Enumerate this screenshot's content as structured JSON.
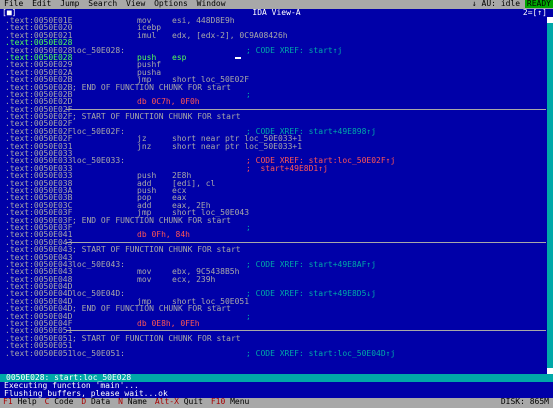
{
  "menu": [
    "File",
    "Edit",
    "Jump",
    "Search",
    "View",
    "Options",
    "Window"
  ],
  "status": {
    "au": "AU: idle",
    "arrow": "↓",
    "ready": "READY"
  },
  "window": {
    "title": "IDA View-A",
    "close": "[■]",
    "number": "2=[↑]"
  },
  "lines": [
    {
      "addr": ".text:0050E01E",
      "mn": "mov",
      "op": "esi, 448D8E9h",
      "pink": false
    },
    {
      "addr": ".text:0050E020",
      "mn": "icebp",
      "op": ""
    },
    {
      "addr": ".text:0050E021",
      "mn": "imul",
      "op": "edx, [edx-2], 0C9A08426h"
    },
    {
      "addr": ".text:0050E028",
      "hl": true
    },
    {
      "addr": ".text:0050E028",
      "lbl": "loc_50E028:",
      "cm": "; CODE XREF: start↑j"
    },
    {
      "addr": ".text:0050E028",
      "hl": true,
      "mn": "push",
      "op": "esp",
      "green": true,
      "cursor": true
    },
    {
      "addr": ".text:0050E029",
      "mn": "pushf",
      "op": ""
    },
    {
      "addr": ".text:0050E02A",
      "mn": "pusha",
      "op": ""
    },
    {
      "addr": ".text:0050E02B",
      "mn": "jmp",
      "op": "short loc_50E02F"
    },
    {
      "addr": ".text:0050E02B",
      "lbl": "; END OF FUNCTION CHUNK FOR start"
    },
    {
      "addr": ".text:0050E02B",
      "cm": ";"
    },
    {
      "addr": ".text:0050E02D",
      "mn": "db 0C7h, 0F0h",
      "db": true
    },
    {
      "addr": ".text:0050E02F",
      "rule": true
    },
    {
      "addr": ".text:0050E02F",
      "lbl": "; START OF FUNCTION CHUNK FOR start"
    },
    {
      "addr": ".text:0050E02F"
    },
    {
      "addr": ".text:0050E02F",
      "lbl": "loc_50E02F:",
      "cm": "; CODE XREF: start+49E898↑j"
    },
    {
      "addr": ".text:0050E02F",
      "mn": "jz",
      "op": "short near ptr loc_50E033+1"
    },
    {
      "addr": ".text:0050E031",
      "mn": "jnz",
      "op": "short near ptr loc_50E033+1"
    },
    {
      "addr": ".text:0050E033"
    },
    {
      "addr": ".text:0050E033",
      "lbl": "loc_50E033:",
      "cm": "; CODE XREF: start:loc_50E02F↑j",
      "red": true
    },
    {
      "addr": ".text:0050E033",
      "cm": ";  start+49E8D1↑j",
      "red": true
    },
    {
      "addr": ".text:0050E033",
      "mn": "push",
      "op": "2E8h"
    },
    {
      "addr": ".text:0050E038",
      "mn": "add",
      "op": "[edi], cl"
    },
    {
      "addr": ".text:0050E03A",
      "mn": "push",
      "op": "ecx"
    },
    {
      "addr": ".text:0050E03B",
      "mn": "pop",
      "op": "eax"
    },
    {
      "addr": ".text:0050E03C",
      "mn": "add",
      "op": "eax, 2Eh"
    },
    {
      "addr": ".text:0050E03F",
      "mn": "jmp",
      "op": "short loc_50E043"
    },
    {
      "addr": ".text:0050E03F",
      "lbl": "; END OF FUNCTION CHUNK FOR start"
    },
    {
      "addr": ".text:0050E03F",
      "cm": ";"
    },
    {
      "addr": ".text:0050E041",
      "mn": "db 0Fh, 84h",
      "db": true
    },
    {
      "addr": ".text:0050E043",
      "rule": true
    },
    {
      "addr": ".text:0050E043",
      "lbl": "; START OF FUNCTION CHUNK FOR start"
    },
    {
      "addr": ".text:0050E043"
    },
    {
      "addr": ".text:0050E043",
      "lbl": "loc_50E043:",
      "cm": "; CODE XREF: start+49E8AF↑j"
    },
    {
      "addr": ".text:0050E043",
      "mn": "mov",
      "op": "ebx, 9C5438B5h"
    },
    {
      "addr": ".text:0050E048",
      "mn": "mov",
      "op": "ecx, 239h"
    },
    {
      "addr": ".text:0050E04D"
    },
    {
      "addr": ".text:0050E04D",
      "lbl": "loc_50E04D:",
      "cm": "; CODE XREF: start+49E8D5↓j"
    },
    {
      "addr": ".text:0050E04D",
      "mn": "jmp",
      "op": "short loc_50E051"
    },
    {
      "addr": ".text:0050E04D",
      "lbl": "; END OF FUNCTION CHUNK FOR start"
    },
    {
      "addr": ".text:0050E04D",
      "cm": ";"
    },
    {
      "addr": ".text:0050E04F",
      "mn": "db 0E8h, 0FEh",
      "db": true
    },
    {
      "addr": ".text:0050E051",
      "rule": true
    },
    {
      "addr": ".text:0050E051",
      "lbl": "; START OF FUNCTION CHUNK FOR start"
    },
    {
      "addr": ".text:0050E051"
    },
    {
      "addr": ".text:0050E051",
      "lbl": "loc_50E051:",
      "cm": "; CODE XREF: start:loc_50E04D↑j"
    }
  ],
  "position": "0050E028: start:loc_50E028",
  "messages": [
    "Executing function 'main'...",
    "Flushing buffers, please wait...ok"
  ],
  "footer": [
    {
      "key": "F1",
      "label": "Help"
    },
    {
      "key": "C",
      "label": "Code"
    },
    {
      "key": "D",
      "label": "Data"
    },
    {
      "key": "N",
      "label": "Name"
    },
    {
      "key": "Alt-X",
      "label": "Quit"
    },
    {
      "key": "F10",
      "label": "Menu"
    }
  ],
  "disk": "DISK: 865M"
}
